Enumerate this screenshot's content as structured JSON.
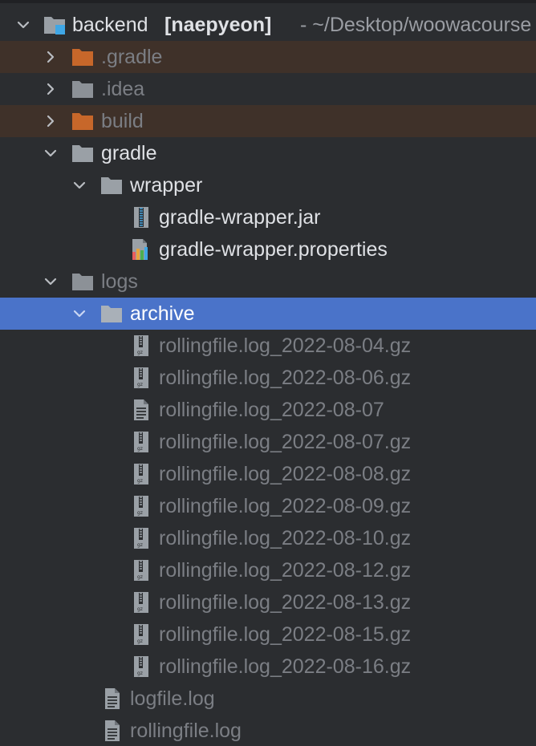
{
  "root": {
    "name": "backend",
    "module": "[naepyeon]",
    "path": "- ~/Desktop/woowacourse"
  },
  "colors": {
    "background": "#2b2d30",
    "selection": "#4a73c9",
    "excluded_row": "#3f3129",
    "excluded_folder": "#c7672a",
    "folder": "#9aa0a6",
    "text": "#dfe1e5",
    "dim_text": "#7b7e84"
  },
  "rows": [
    {
      "label": ".gradle",
      "kind": "folder-excluded",
      "expanded": false
    },
    {
      "label": ".idea",
      "kind": "folder",
      "expanded": false
    },
    {
      "label": "build",
      "kind": "folder-excluded",
      "expanded": false
    },
    {
      "label": "gradle",
      "kind": "folder",
      "expanded": true
    },
    {
      "label": "wrapper",
      "kind": "folder",
      "expanded": true
    },
    {
      "label": "gradle-wrapper.jar",
      "kind": "archive-file-icon"
    },
    {
      "label": "gradle-wrapper.properties",
      "kind": "properties-file-icon"
    },
    {
      "label": "logs",
      "kind": "folder",
      "expanded": true
    },
    {
      "label": "archive",
      "kind": "folder",
      "expanded": true,
      "selected": true
    },
    {
      "label": "rollingfile.log_2022-08-04.gz",
      "kind": "gz-file-icon"
    },
    {
      "label": "rollingfile.log_2022-08-06.gz",
      "kind": "gz-file-icon"
    },
    {
      "label": "rollingfile.log_2022-08-07",
      "kind": "text-file-icon"
    },
    {
      "label": "rollingfile.log_2022-08-07.gz",
      "kind": "gz-file-icon"
    },
    {
      "label": "rollingfile.log_2022-08-08.gz",
      "kind": "gz-file-icon"
    },
    {
      "label": "rollingfile.log_2022-08-09.gz",
      "kind": "gz-file-icon"
    },
    {
      "label": "rollingfile.log_2022-08-10.gz",
      "kind": "gz-file-icon"
    },
    {
      "label": "rollingfile.log_2022-08-12.gz",
      "kind": "gz-file-icon"
    },
    {
      "label": "rollingfile.log_2022-08-13.gz",
      "kind": "gz-file-icon"
    },
    {
      "label": "rollingfile.log_2022-08-15.gz",
      "kind": "gz-file-icon"
    },
    {
      "label": "rollingfile.log_2022-08-16.gz",
      "kind": "gz-file-icon"
    },
    {
      "label": "logfile.log",
      "kind": "text-file-icon"
    },
    {
      "label": "rollingfile.log",
      "kind": "text-file-icon"
    }
  ]
}
